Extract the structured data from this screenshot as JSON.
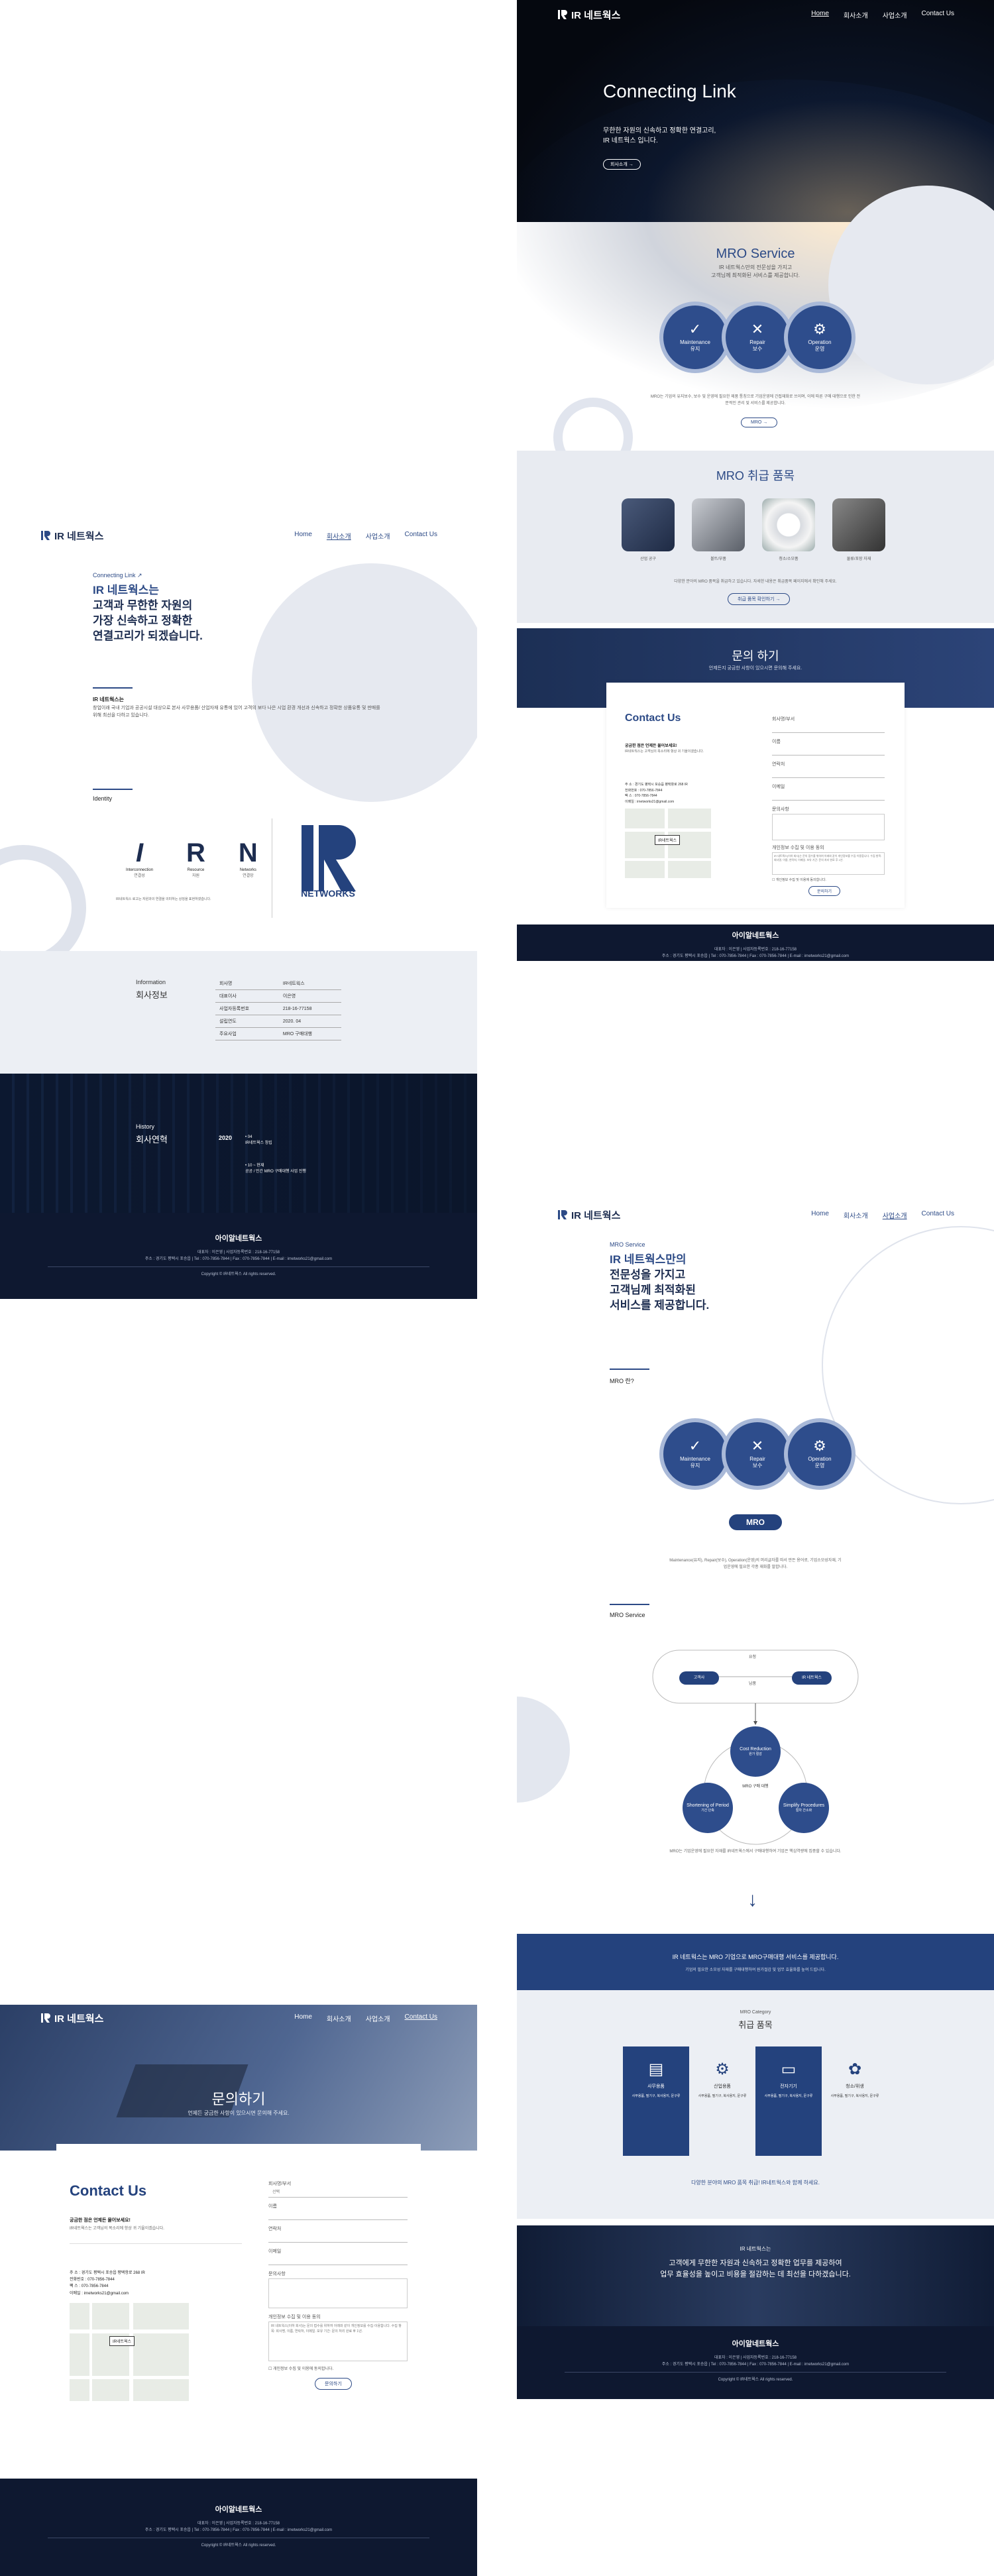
{
  "brand": {
    "name": "IR 네트웍스",
    "footer_name": "아이알네트웍스"
  },
  "nav": {
    "home": "Home",
    "company": "회사소개",
    "business": "사업소개",
    "contact": "Contact Us"
  },
  "home": {
    "hero_title": "Connecting Link",
    "hero_sub1": "무한한 자원의 신속하고 정확한 연결고리,",
    "hero_sub2": "IR 네트웍스 입니다.",
    "hero_btn": "회사소개 →",
    "mro_title": "MRO Service",
    "mro_sub1": "IR 네트웍스만의 전문성을 가지고",
    "mro_sub2": "고객님께 최적화된 서비스를 제공합니다.",
    "circles": [
      {
        "en": "Maintenance",
        "ko": "유지",
        "icon": "✓"
      },
      {
        "en": "Repair",
        "ko": "보수",
        "icon": "✕"
      },
      {
        "en": "Operation",
        "ko": "운영",
        "icon": "⚙"
      }
    ],
    "mro_desc": "MRO는 기업의 유지보수, 보수 및 운영에 필요한 제품 통칭으로 기업운영에 간접재화로 쓰이며, 이에 따른 구매 대행으로 인한 전문적인 관리 및 서비스를 제공합니다.",
    "mro_btn": "MRO →",
    "items_title": "MRO 취급 품목",
    "items": [
      "산업 공구",
      "볼트/부품",
      "청소/소모품",
      "물류/포장 자재"
    ],
    "items_desc": "다양한 분야의 MRO 품목을 취급하고 있습니다. 자세한 내용은 취급품목 페이지에서 확인해 주세요.",
    "items_btn": "취급 품목 확인하기 →",
    "contact_banner": "문의 하기",
    "contact_banner_sub": "언제든지 궁금한 사항이 있으시면 문의해 주세요."
  },
  "contact": {
    "title": "Contact Us",
    "q": "궁금한 점은 언제든 물어보세요!",
    "desc": "IR네트웍스는 고객님의 목소리에 항상 귀 기울이겠습니다.",
    "addr_label": "주 소",
    "addr": "경기도 평택시 포승읍 평택항로 268 IR",
    "tel_label": "전화번호",
    "tel": "070-7856-7844",
    "fax_label": "팩 스",
    "fax": "070-7856-7844",
    "mail_label": "이메일",
    "mail": "irnetworks21@gmail.com",
    "map_pin": "IR네트웍스",
    "form": {
      "company": "회사명/부서",
      "name": "이름",
      "phone": "연락처",
      "email": "이메일",
      "inquiry": "문의사항",
      "privacy": "개인정보 수집 및 이용 동의",
      "agree": "개인정보 수집 및 이용에 동의합니다.",
      "submit": "문의하기"
    },
    "form_placeholder": "선택",
    "privacy_text": "IR 네트웍스(이하 회사)는 문의 접수를 위하여 아래와 같이 개인정보를 수집·이용합니다. 수집 항목: 회사명, 이름, 연락처, 이메일. 보유 기간: 문의 처리 완료 후 1년."
  },
  "about": {
    "tag": "Connecting Link ↗",
    "title1": "IR 네트웍스는",
    "title2": "고객과 무한한 자원의",
    "title3": "가장 신속하고 정확한",
    "title4": "연결고리가 되겠습니다.",
    "desc_title": "IR 네트웍스는",
    "desc": "창업이래 국내 기업과 공공시설 대상으로 본사 사무용품/ 산업자재 유통에 있어 고객의 보다 나은 시업 환경 개선과 신속하고 정확한 상품유통 및 판매를 위해 최선을 다하고 있습니다.",
    "identity": "Identity",
    "letters": [
      {
        "l": "I",
        "en": "Interconnection",
        "ko": "연결성"
      },
      {
        "l": "R",
        "en": "Resource",
        "ko": "자원"
      },
      {
        "l": "N",
        "en": "Networks",
        "ko": "연결망"
      }
    ],
    "identity_desc": "IR네트웍스 로고는 자원과의 연결을 의미하는 상징을 표현하였습니다.",
    "logo_word": "NETWORKS",
    "info_en": "Information",
    "info_ko": "회사정보",
    "info_rows": [
      [
        "회사명",
        "IR네트웍스"
      ],
      [
        "대표이사",
        "이은영"
      ],
      [
        "사업자등록번호",
        "218-16-77158"
      ],
      [
        "설립연도",
        "2020. 04"
      ],
      [
        "주요사업",
        "MRO 구매대행"
      ]
    ],
    "hist_en": "History",
    "hist_ko": "회사연혁",
    "hist_year1": "2020",
    "hist_item1a": "04",
    "hist_item1b": "IR네트웍스 창립",
    "hist_item2a": "10 ~ 현재",
    "hist_item2b": "공공 / 민간 MRO 구매대행 사업 진행"
  },
  "service": {
    "tag": "MRO Service",
    "title1": "IR 네트웍스만의",
    "title2": "전문성을 가지고",
    "title3": "고객님께 최적화된",
    "title4": "서비스를 제공합니다.",
    "q": "MRO 란?",
    "mro_label": "MRO",
    "desc": "Maintenance(유지), Repair(보수), Operation(운영)의 머리글자를 따서 만든 용어로, 기업소모성자재, 기업운영에 필요한 각종 재화를 말합니다.",
    "svc_label": "MRO Service",
    "nodes": {
      "left": "고객사",
      "right": "IR 네트웍스",
      "top": "요청",
      "mid": "납품"
    },
    "cost_en": "Cost Reduction",
    "cost_ko": "원가 절감",
    "short_en": "Shortening of Period",
    "short_ko": "기간 단축",
    "simp_en": "Simplify Procedures",
    "simp_ko": "절차 간소화",
    "center": "MRO 구매 대행",
    "svc_desc": "MRO는 기업운영에 필요한 자재를 IR네트웍스에서 구매대행하여 기업은 핵심역량에 집중할 수 있습니다.",
    "banner": "IR 네트웍스는 MRO 기업으로 MRO구매대행 서비스를 제공합니다.",
    "banner_sub": "기업의 필요한 소모성 자재를 구매대행하여 원가절감 및 업무 효율화를 높여 드립니다.",
    "cat_en": "MRO Category",
    "cat_ko": "취급 품목",
    "cats": [
      {
        "t": "사무용품",
        "icon": "▤",
        "on": true
      },
      {
        "t": "산업용품",
        "icon": "⚙",
        "on": false
      },
      {
        "t": "전자기기",
        "icon": "▭",
        "on": true
      },
      {
        "t": "청소/위생",
        "icon": "✿",
        "on": false
      }
    ],
    "cat_list": "사무용품, 필기구, 복사용지, 문구류",
    "cat_desc": "다양한 분야의 MRO 품목 취급! IR네트웍스와 함께 하세요.",
    "bottom1": "IR 네트웍스는",
    "bottom2": "고객에게 무한한 자원과 신속하고 정확한 업무를 제공하여",
    "bottom3": "업무 효율성을 높이고 비용을 절감하는 데 최선을 다하겠습니다."
  },
  "contact_page": {
    "title": "문의하기",
    "sub": "언제든 궁금한 사항이 있으시면 문의해 주세요."
  },
  "footer": {
    "l1": "대표자 : 이은영 | 사업자등록번호 : 218-16-77158",
    "l2": "주소 : 경기도 평택시 포승읍 | Tel : 070-7856-7844 | Fax : 070-7856-7844 | E-mail : irnetworks21@gmail.com",
    "copy": "Copyright © IR네트웍스 All rights reserved."
  }
}
